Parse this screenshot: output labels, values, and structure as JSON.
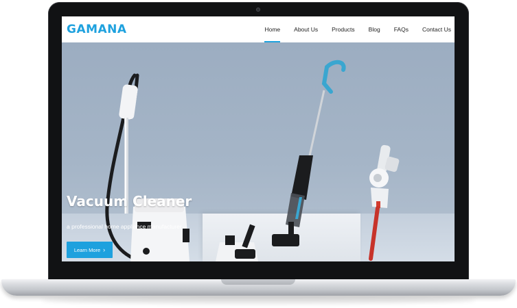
{
  "brand": {
    "logo_text": "GAMANA",
    "accent_color": "#1ea1de"
  },
  "nav": {
    "items": [
      {
        "label": "Home",
        "active": true
      },
      {
        "label": "About Us",
        "active": false
      },
      {
        "label": "Products",
        "active": false
      },
      {
        "label": "Blog",
        "active": false
      },
      {
        "label": "FAQs",
        "active": false
      },
      {
        "label": "Contact Us",
        "active": false
      }
    ]
  },
  "hero": {
    "title": "Vacuum Cleaner",
    "subtitle": "a professional home appliance manufacturer",
    "cta_label": "Learn More",
    "cta_icon": "chevron-right-icon"
  }
}
